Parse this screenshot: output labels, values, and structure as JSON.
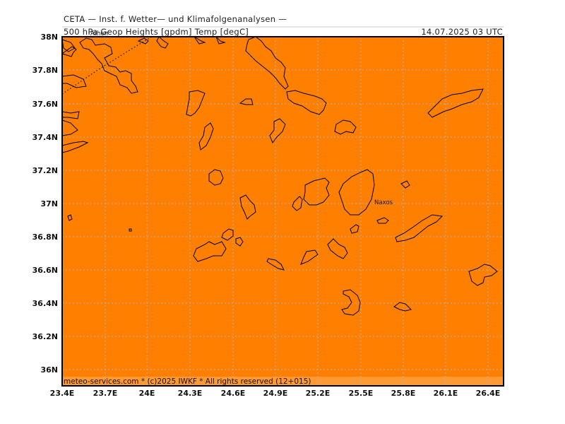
{
  "header": {
    "center": "CETA — Inst. f. Wetter— und Klimafolgenanalysen —",
    "parameter": "500 hPa Geop Heights [gpdm] Temp [degC]",
    "datetime": "14.07.2025 03 UTC"
  },
  "footer": {
    "credit": "meteo-services.com * (c)2025 IWKF * All rights reserved (12+015)"
  },
  "map": {
    "fill_color": "#ff8000",
    "coast_color": "#000000",
    "grid_color": "#b0b0b0",
    "lon_range": [
      23.4,
      26.5
    ],
    "lat_range": [
      35.9,
      37.95
    ],
    "x_ticks": [
      "23.4E",
      "23.7E",
      "24E",
      "24.3E",
      "24.6E",
      "24.9E",
      "25.2E",
      "25.5E",
      "25.8E",
      "26.1E",
      "26.4E"
    ],
    "y_ticks": [
      "38N",
      "37.8N",
      "37.6N",
      "37.4N",
      "37.2N",
      "37N",
      "36.8N",
      "36.6N",
      "36.4N",
      "36.2N",
      "36N"
    ],
    "labels": {
      "naxos": "Naxos",
      "athens_partial": "Athen"
    }
  }
}
